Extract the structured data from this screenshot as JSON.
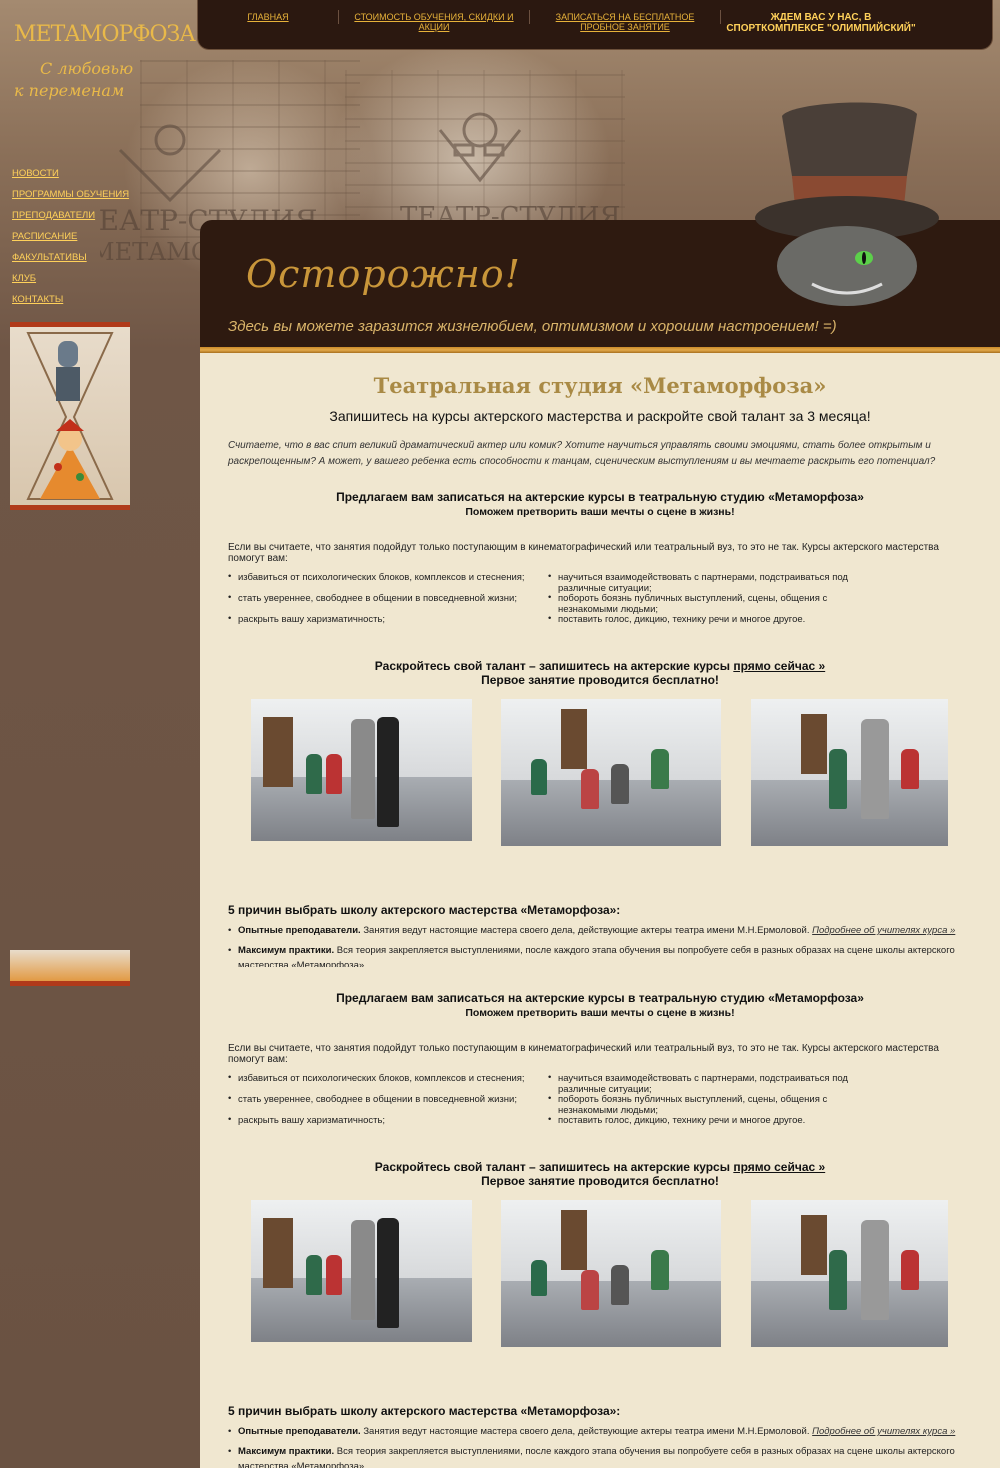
{
  "top_nav": {
    "items": [
      {
        "label": "Главная"
      },
      {
        "label": "Стоимость обучения, скидки и акции"
      },
      {
        "label": "Записаться на бесплатное пробное занятие"
      }
    ],
    "promo": "Ждем вас у нас, в спорткомплексе \"Олимпийский\""
  },
  "logo": {
    "title": "МЕТАМОРФОЗА",
    "subtitle_1": "С любовью",
    "subtitle_2": "к переменам"
  },
  "side_menu": {
    "items": [
      {
        "label": "Новости"
      },
      {
        "label": "Программы обучения"
      },
      {
        "label": "Преподаватели"
      },
      {
        "label": "Расписание"
      },
      {
        "label": "Факультативы"
      },
      {
        "label": "Клуб"
      },
      {
        "label": "Контакты"
      }
    ]
  },
  "banner": {
    "headline": "Осторожно!",
    "tagline": "Здесь вы можете заразится жизнелюбием, оптимизмом и хорошим настроением! =)"
  },
  "main": {
    "title": "Театральная студия «Метаморфоза»",
    "lead": "Запишитесь на курсы актерского мастерства и раскройте свой талант за 3 месяца!",
    "intro": "Считаете, что в вас спит великий драматический актер или комик? Хотите научиться управлять своими эмоциями, стать более открытым и раскрепощенным? А может, у вашего ребенка есть способности к танцам, сценическим выступлениям и вы мечтаете раскрыть его потенциал?",
    "offer_title": "Предлагаем вам записаться на актерские курсы в театральную студию «Метаморфоза»",
    "offer_sub": "Поможем претворить ваши мечты о сцене в жизнь!",
    "benefits_intro": "Если вы считаете, что занятия подойдут только поступающим в кинематографический или театральный вуз, то это не так. Курсы актерского мастерства помогут вам:",
    "benefits_left": [
      "избавиться от психологических блоков, комплексов и стеснения;",
      "стать увереннее, свободнее в общении в повседневной жизни;",
      "раскрыть вашу харизматичность;"
    ],
    "benefits_right": [
      "научиться взаимодействовать с партнерами, подстраиваться под различные ситуации;",
      "побороть боязнь публичных выступлений, сцены, общения с незнакомыми людьми;",
      "поставить голос, дикцию, технику речи и многое другое."
    ],
    "cta_text": "Раскройтесь свой талант – запишитесь на актерские курсы",
    "cta_link": "прямо сейчас »",
    "cta_sub": "Первое занятие проводится бесплатно!",
    "reasons_title": "5 причин выбрать школу актерского мастерства «Метаморфоза»:",
    "reason_1_bold": "Опытные преподаватели.",
    "reason_1_text": "Занятия ведут настоящие мастера своего дела, действующие актеры театра имени М.Н.Ермоловой.",
    "reason_1_link": "Подробнее об учителях курса »",
    "reason_2_bold": "Максимум практики.",
    "reason_2_text": "Вся теория закрепляется выступлениями, после каждого этапа обучения вы попробуете себя в разных образах на сцене школы актерского мастерства «Метаморфоза»."
  },
  "colors": {
    "nav_bg": "#2b1810",
    "nav_link": "#e7b23a",
    "content_bg": "#f0e7d0",
    "sidebar_bg": "#6f5646",
    "title_gold": "#a98a45"
  }
}
